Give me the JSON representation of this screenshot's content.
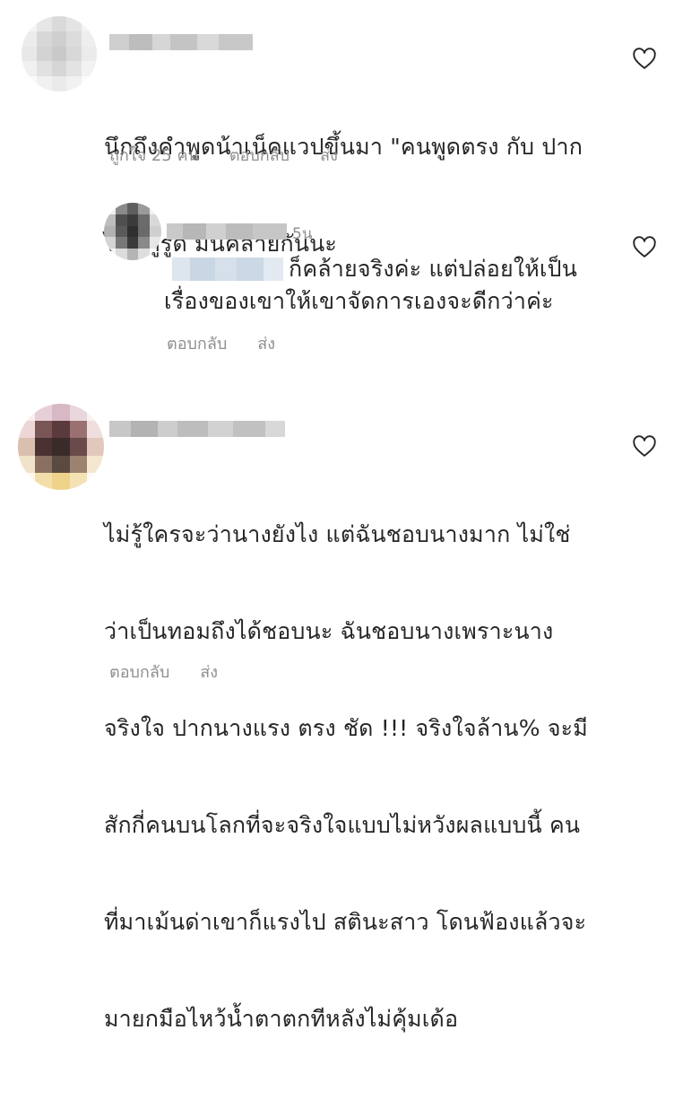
{
  "comments": [
    {
      "text_lines": [
        "นึกถึงคำพูดน้าเน็คแวปขึ้นมา \"คนพูดตรง กับ ปาก",
        "ไม่มีหูรูด มันคล้ายกันนะ"
      ],
      "likes": "ถูกใจ 25 คน",
      "reply": "ตอบกลับ",
      "send": "ส่ง"
    },
    {
      "time": "5น",
      "text_lines": [
        "ก็คล้ายจริงค่ะ แต่ปล่อยให้เป็น",
        "เรื่องของเขาให้เขาจัดการเองจะดีกว่าค่ะ"
      ],
      "reply": "ตอบกลับ",
      "send": "ส่ง"
    },
    {
      "text_lines": [
        "ไม่รู้ใครจะว่านางยังไง แต่ฉันชอบนางมาก ไม่ใช่",
        "ว่าเป็นทอมถึงได้ชอบนะ ฉันชอบนางเพราะนาง",
        "จริงใจ ปากนางแรง ตรง ชัด !!! จริงใจล้าน% จะมี",
        "สักกี่คนบนโลกที่จะจริงใจแบบไม่หวังผลแบบนี้ คน",
        "ที่มาเม้นด่าเขาก็แรงไป สตินะสาว โดนฟ้องแล้วจะ",
        "มายกมือไหว้น้ำตาตกทีหลังไม่คุ้มเด้อ"
      ],
      "reply": "ตอบกลับ",
      "send": "ส่ง"
    }
  ],
  "icons": {
    "like": "heart-outline-icon"
  },
  "colors": {
    "text": "#262626",
    "secondary": "#8e8e8e"
  }
}
